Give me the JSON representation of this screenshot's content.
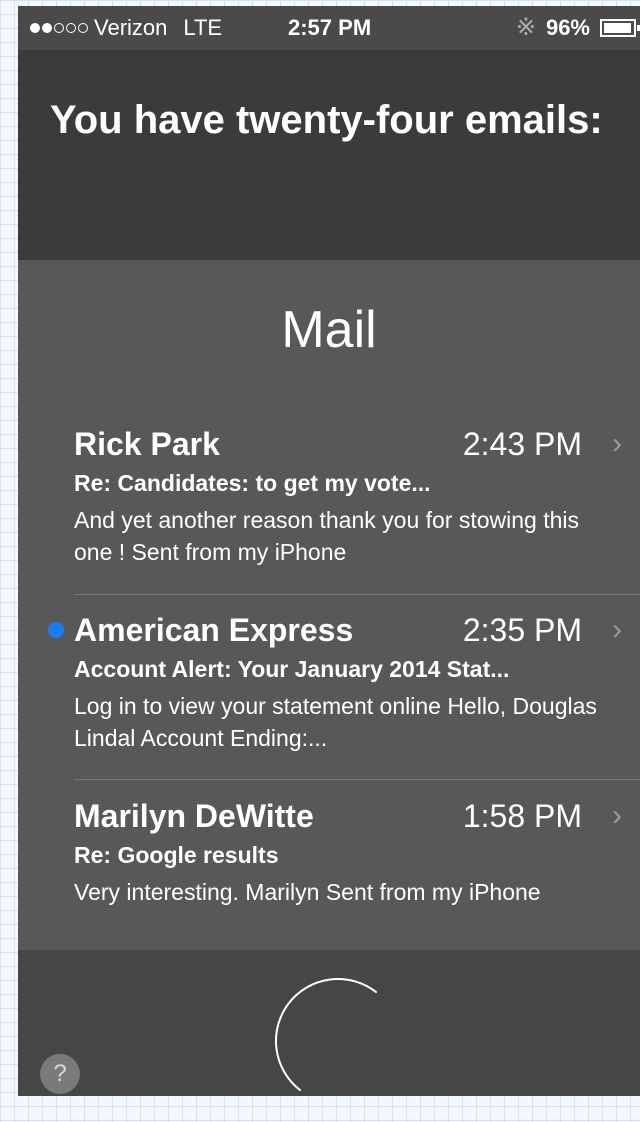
{
  "status_bar": {
    "signal_filled": 2,
    "signal_total": 5,
    "carrier": "Verizon",
    "network": "LTE",
    "time": "2:57 PM",
    "battery": "96%",
    "battery_level": 0.96
  },
  "siri": {
    "response": "You have twenty-four emails:"
  },
  "mail": {
    "title": "Mail",
    "emails": [
      {
        "sender": "Rick Park",
        "time": "2:43 PM",
        "subject": "Re: Candidates: to get my vote...",
        "preview": "And yet another reason thank you for stowing this one ! Sent from my iPhone",
        "unread": false
      },
      {
        "sender": "American Express",
        "time": "2:35 PM",
        "subject": "Account Alert: Your January 2014 Stat...",
        "preview": "Log in to view your statement online Hello, Douglas Lindal Account Ending:...",
        "unread": true
      },
      {
        "sender": "Marilyn DeWitte",
        "time": "1:58 PM",
        "subject": "Re: Google results",
        "preview": "Very interesting. Marilyn Sent from my iPhone",
        "unread": false
      }
    ]
  },
  "bottom": {
    "help_label": "?"
  },
  "icons": {
    "bluetooth": "bluetooth-icon",
    "battery": "battery-icon",
    "chevron": "chevron-right-icon",
    "siri": "siri-microphone-icon"
  },
  "colors": {
    "unread_dot": "#1a7cf5"
  }
}
